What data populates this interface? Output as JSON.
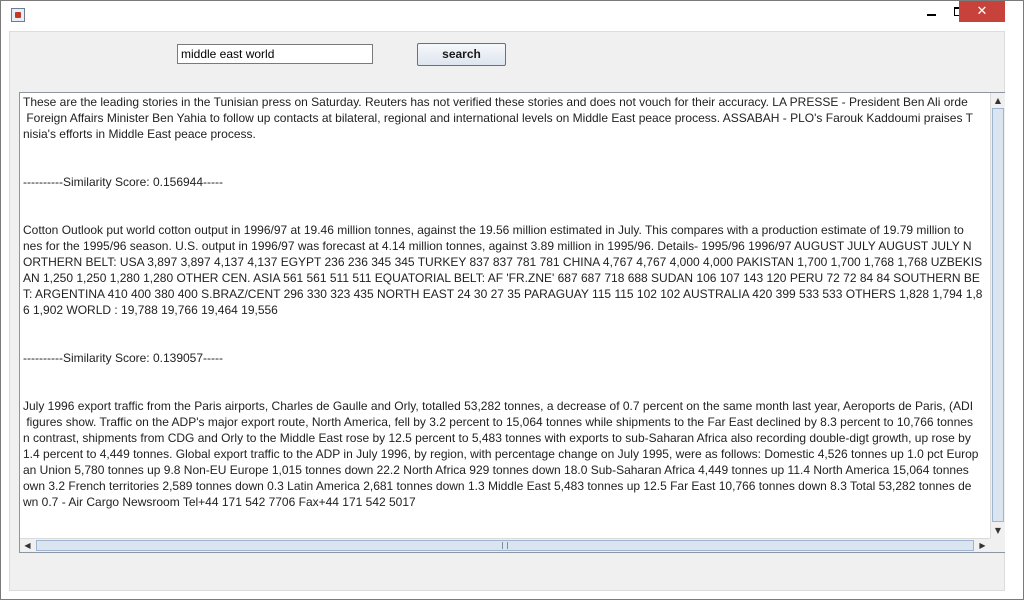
{
  "window": {
    "close_glyph": "✕"
  },
  "search": {
    "value": "middle east world",
    "button_label": "search"
  },
  "result_text": "These are the leading stories in the Tunisian press on Saturday. Reuters has not verified these stories and does not vouch for their accuracy. LA PRESSE - President Ben Ali orde\n Foreign Affairs Minister Ben Yahia to follow up contacts at bilateral, regional and international levels on Middle East peace process. ASSABAH - PLO's Farouk Kaddoumi praises T\nnisia's efforts in Middle East peace process.\n\n\n----------Similarity Score: 0.156944-----\n\n\nCotton Outlook put world cotton output in 1996/97 at 19.46 million tonnes, against the 19.56 million estimated in July. This compares with a production estimate of 19.79 million to\nnes for the 1995/96 season. U.S. output in 1996/97 was forecast at 4.14 million tonnes, against 3.89 million in 1995/96. Details- 1995/96 1996/97 AUGUST JULY AUGUST JULY N\nORTHERN BELT: USA 3,897 3,897 4,137 4,137 EGYPT 236 236 345 345 TURKEY 837 837 781 781 CHINA 4,767 4,767 4,000 4,000 PAKISTAN 1,700 1,700 1,768 1,768 UZBEKIS\nAN 1,250 1,250 1,280 1,280 OTHER CEN. ASIA 561 561 511 511 EQUATORIAL BELT: AF 'FR.ZNE' 687 687 718 688 SUDAN 106 107 143 120 PERU 72 72 84 84 SOUTHERN BE\nT: ARGENTINA 410 400 380 400 S.BRAZ/CENT 296 330 323 435 NORTH EAST 24 30 27 35 PARAGUAY 115 115 102 102 AUSTRALIA 420 399 533 533 OTHERS 1,828 1,794 1,8\n6 1,902 WORLD : 19,788 19,766 19,464 19,556\n\n\n----------Similarity Score: 0.139057-----\n\n\nJuly 1996 export traffic from the Paris airports, Charles de Gaulle and Orly, totalled 53,282 tonnes, a decrease of 0.7 percent on the same month last year, Aeroports de Paris, (ADI\n figures show. Traffic on the ADP's major export route, North America, fell by 3.2 percent to 15,064 tonnes while shipments to the Far East declined by 8.3 percent to 10,766 tonnes\nn contrast, shipments from CDG and Orly to the Middle East rose by 12.5 percent to 5,483 tonnes with exports to sub-Saharan Africa also recording double-digt growth, up rose by\n1.4 percent to 4,449 tonnes. Global export traffic to the ADP in July 1996, by region, with percentage change on July 1995, were as follows: Domestic 4,526 tonnes up 1.0 pct Europ\nan Union 5,780 tonnes up 9.8 Non-EU Europe 1,015 tonnes down 22.2 North Africa 929 tonnes down 18.0 Sub-Saharan Africa 4,449 tonnes up 11.4 North America 15,064 tonnes\nown 3.2 French territories 2,589 tonnes down 0.3 Latin America 2,681 tonnes down 1.3 Middle East 5,483 tonnes up 12.5 Far East 10,766 tonnes down 8.3 Total 53,282 tonnes de\nwn 0.7 - Air Cargo Newsroom Tel+44 171 542 7706 Fax+44 171 542 5017",
  "scrollbars": {
    "up_arrow": "▲",
    "down_arrow": "▼",
    "left_arrow": "◀",
    "right_arrow": "▶"
  }
}
